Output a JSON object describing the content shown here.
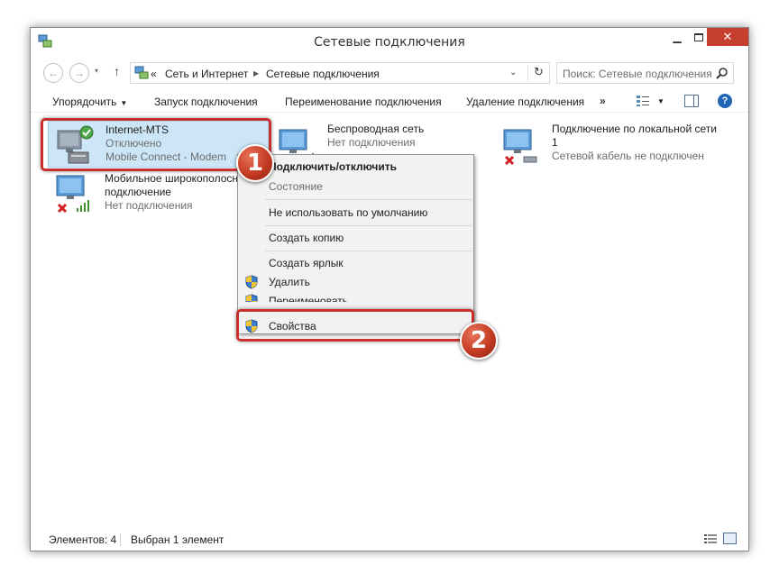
{
  "window": {
    "title": "Сетевые подключения"
  },
  "address": {
    "prefix": "«",
    "crumbs": [
      "Сеть и Интернет",
      "Сетевые подключения"
    ],
    "search_placeholder": "Поиск: Сетевые подключения"
  },
  "toolbar": {
    "organize": "Упорядочить",
    "start": "Запуск подключения",
    "rename": "Переименование подключения",
    "delete": "Удаление подключения",
    "more": "»"
  },
  "connections": [
    {
      "name": "Internet-MTS",
      "status": "Отключено",
      "device": "Mobile Connect - Modem",
      "selected": true
    },
    {
      "name": "Беспроводная сеть",
      "status": "Нет подключения",
      "device": ""
    },
    {
      "name": "Подключение по локальной сети",
      "name_line2": "1",
      "status": "Сетевой кабель не подключен"
    },
    {
      "name": "Мобильное широкополосное",
      "name_line2": "подключение",
      "status": "Нет подключения"
    }
  ],
  "context_menu": {
    "items": [
      {
        "label": "Подключить/отключить",
        "style": "bold"
      },
      {
        "label": "Состояние",
        "style": "disabled"
      },
      {
        "label": "Не использовать по умолчанию"
      },
      {
        "label": "Создать копию"
      },
      {
        "label": "Создать ярлык"
      },
      {
        "label": "Удалить",
        "icon": "shield-icon"
      },
      {
        "label": "Переименовать",
        "icon": "shield-icon"
      },
      {
        "label": "Свойства",
        "icon": "shield-icon"
      }
    ]
  },
  "callouts": {
    "one": "1",
    "two": "2"
  },
  "status_bar": {
    "count": "Элементов: 4",
    "selection": "Выбран 1 элемент"
  },
  "colors": {
    "close_button": "#c7402f",
    "selection": "#cce6f7",
    "callout_border": "#c9302c",
    "callout_badge": "#c43b22"
  }
}
